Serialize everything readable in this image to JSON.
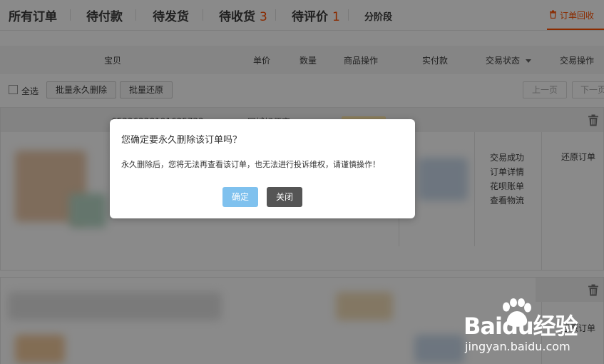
{
  "tabs": [
    {
      "label": "所有订单",
      "count": ""
    },
    {
      "label": "待付款",
      "count": ""
    },
    {
      "label": "待发货",
      "count": ""
    },
    {
      "label": "待收货",
      "count": "3"
    },
    {
      "label": "待评价",
      "count": "1"
    },
    {
      "label": "分阶段",
      "count": ""
    }
  ],
  "recycle_label": "订单回收",
  "table_header": {
    "item": "宝贝",
    "price": "单价",
    "qty": "数量",
    "item_ops": "商品操作",
    "paid": "实付款",
    "trade_status": "交易状态",
    "trade_ops": "交易操作"
  },
  "bulk": {
    "select_all": "全选",
    "perm_delete": "批量永久删除",
    "restore_all": "批量还原",
    "prev": "上一页",
    "next": "下一页"
  },
  "order1": {
    "order_no": "65226228191625722",
    "shop": "同城好便宜",
    "status": [
      "交易成功",
      "订单详情",
      "花呗账单",
      "查看物流"
    ],
    "restore": "还原订单"
  },
  "order2": {
    "restore": "还原订单"
  },
  "dialog": {
    "title": "您确定要永久删除该订单吗？",
    "message": "永久删除后，您将无法再查看该订单，也无法进行投诉维权，请谨慎操作！",
    "confirm": "确定",
    "close": "关闭"
  },
  "watermark": {
    "logo": "Baidu经验",
    "url": "jingyan.baidu.com"
  },
  "colors": {
    "accent": "#ff5000",
    "confirm": "#7fc1ee",
    "close": "#555555"
  }
}
